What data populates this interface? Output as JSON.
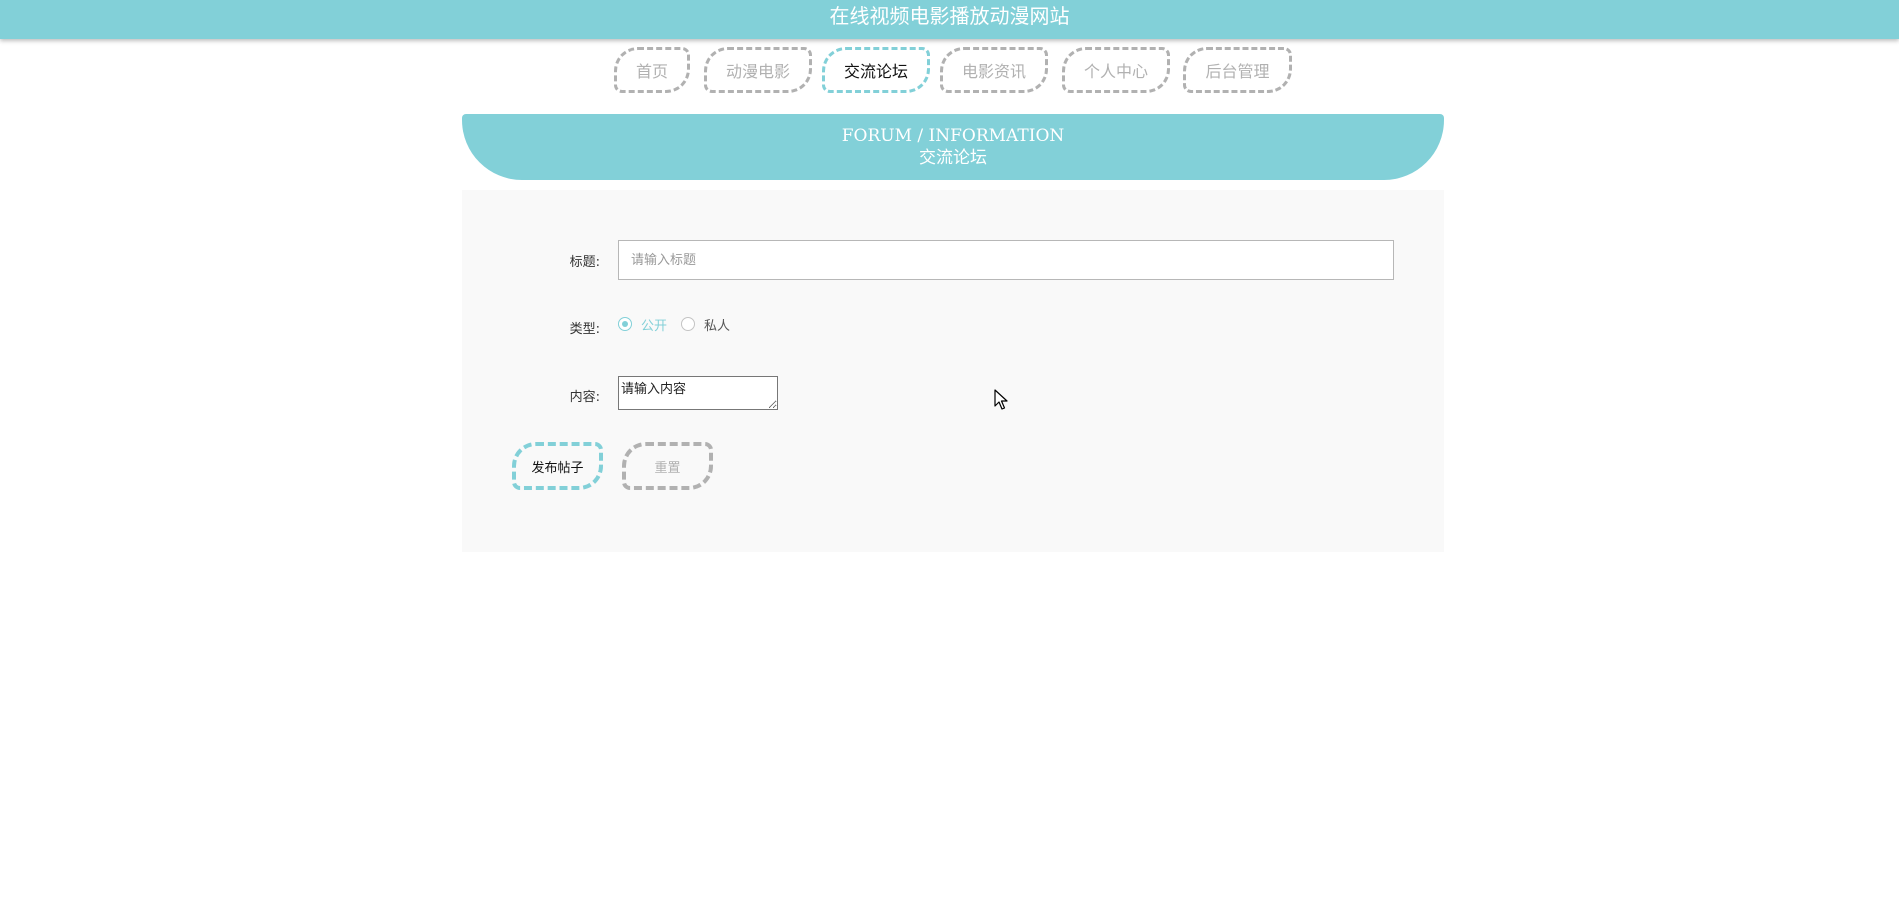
{
  "header": {
    "site_title": "在线视频电影播放动漫网站"
  },
  "nav": {
    "items": [
      {
        "label": "首页"
      },
      {
        "label": "动漫电影"
      },
      {
        "label": "交流论坛"
      },
      {
        "label": "电影资讯"
      },
      {
        "label": "个人中心"
      },
      {
        "label": "后台管理"
      }
    ],
    "active": "交流论坛"
  },
  "banner": {
    "en": "FORUM / INFORMATION",
    "cn": "交流论坛"
  },
  "form": {
    "title_label": "标题:",
    "title_placeholder": "请输入标题",
    "type_label": "类型:",
    "type_options": [
      {
        "label": "公开",
        "checked": true
      },
      {
        "label": "私人",
        "checked": false
      }
    ],
    "content_label": "内容:",
    "content_value": "请输入内容",
    "submit_label": "发布帖子",
    "reset_label": "重置"
  },
  "colors": {
    "accent": "#82d0d8",
    "inactive": "#b1b1b1",
    "panel_bg": "#f9f9f9"
  }
}
